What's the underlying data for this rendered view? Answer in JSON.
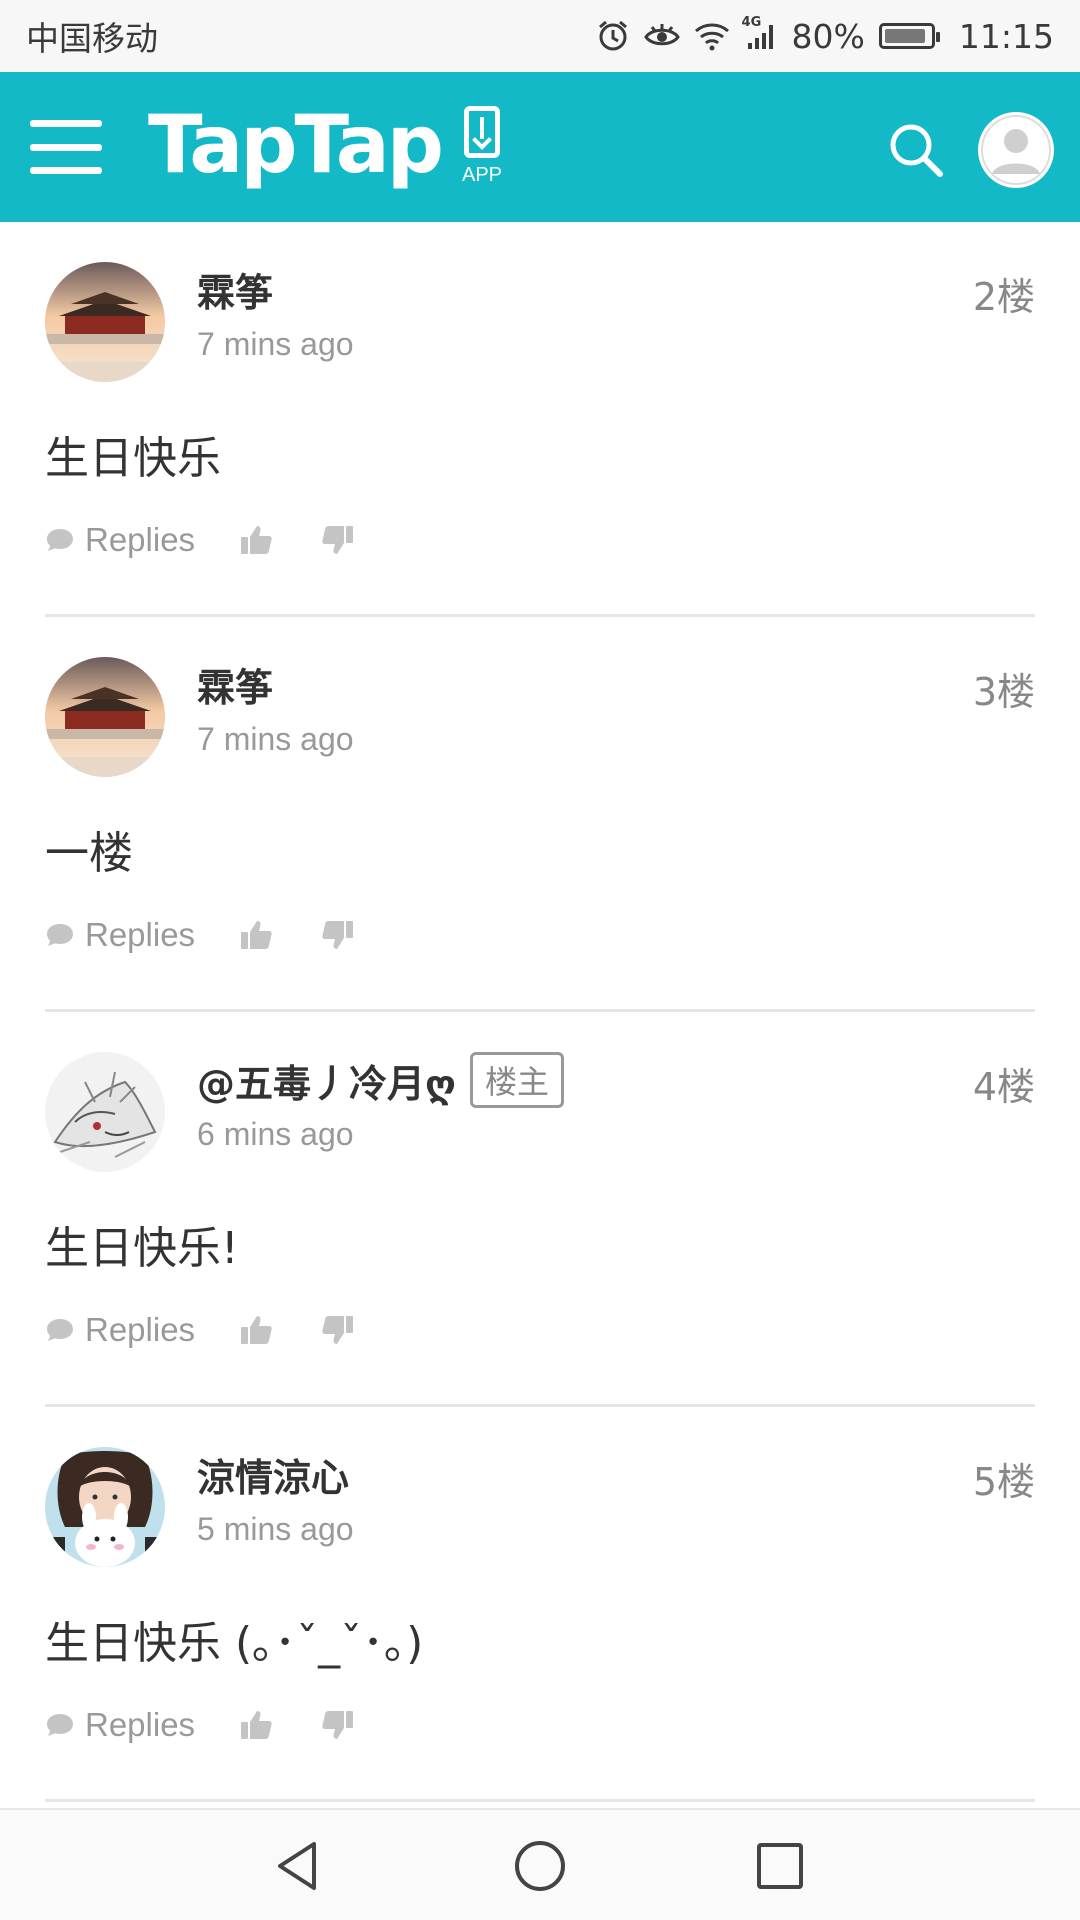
{
  "status_bar": {
    "carrier": "中国移动",
    "network": "4G",
    "battery": "80%",
    "time": "11:15"
  },
  "header": {
    "logo": "TapTap",
    "app_label": "APP"
  },
  "posts": [
    {
      "name": "霖筝",
      "time": "7 mins ago",
      "floor": "2楼",
      "content": "生日快乐",
      "replies_label": "Replies",
      "avatar": "palace-photo"
    },
    {
      "name": "霖筝",
      "time": "7 mins ago",
      "floor": "3楼",
      "content": "一楼",
      "replies_label": "Replies",
      "avatar": "palace-photo"
    },
    {
      "name": "@五毒丿冷月ღ",
      "badge": "楼主",
      "time": "6 mins ago",
      "floor": "4楼",
      "content": "生日快乐!",
      "replies_label": "Replies",
      "avatar": "ink-fox-drawing"
    },
    {
      "name": "涼情涼心",
      "time": "5 mins ago",
      "floor": "5楼",
      "content": "生日快乐 (｡･ˇ_ˇ･｡)",
      "replies_label": "Replies",
      "avatar": "girl-with-bunny-photo"
    }
  ],
  "colors": {
    "header_bg": "#14b9c8",
    "divider": "#e6e6e6",
    "muted_text": "#999999"
  }
}
